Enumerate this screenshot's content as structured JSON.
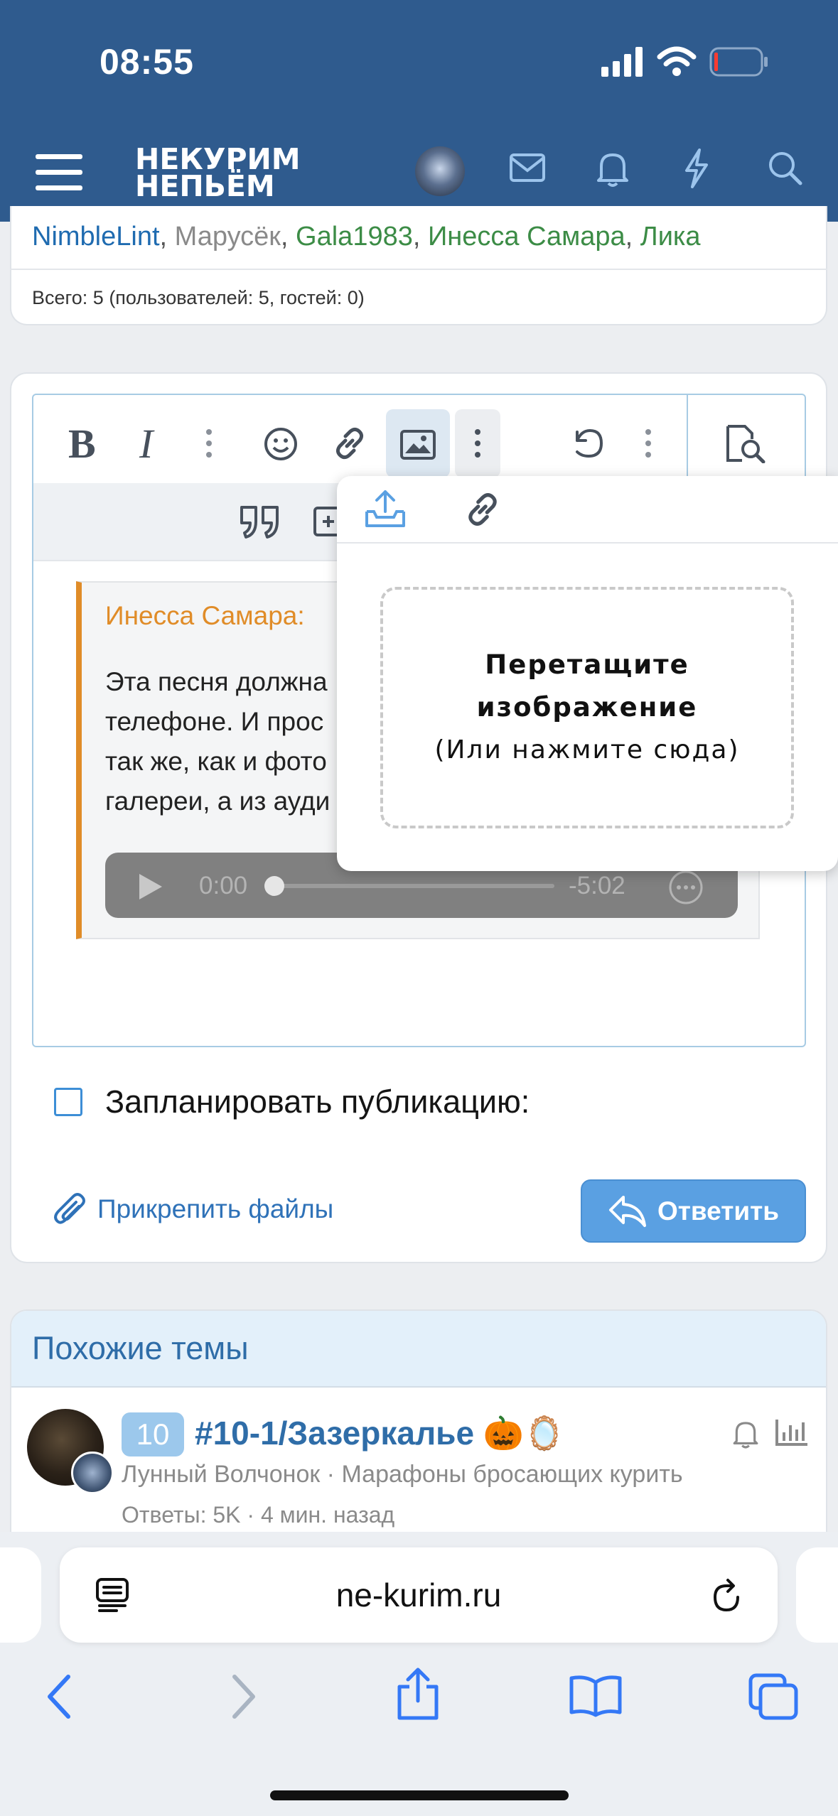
{
  "status_bar": {
    "time": "08:55"
  },
  "header": {
    "logo_line1": "НЕКУРИМ",
    "logo_line2": "НЕПЬЁМ"
  },
  "online": {
    "names": [
      {
        "text": "NimbleLint",
        "style": "blue"
      },
      {
        "text": "Марусёк",
        "style": "grey"
      },
      {
        "text": "Gala1983",
        "style": "green"
      },
      {
        "text": "Инесса Самара",
        "style": "green"
      },
      {
        "text": "Лика",
        "style": "green"
      }
    ],
    "separator": ", ",
    "total": "Всего: 5 (пользователей: 5, гостей: 0)"
  },
  "editor": {
    "quote_author": "Инесса Самара:",
    "quote_lines": [
      "Эта песня должна",
      "телефоне. И прос",
      "так же, как и фото",
      "галереи, а из ауди"
    ],
    "audio": {
      "current": "0:00",
      "remaining": "-5:02"
    }
  },
  "image_popup": {
    "drop_title": "Перетащите изображение",
    "drop_subtitle": "(Или нажмите сюда)"
  },
  "schedule_label": "Запланировать публикацию:",
  "attach_label": "Прикрепить файлы",
  "reply_label": "Ответить",
  "similar": {
    "title": "Похожие темы",
    "thread": {
      "badge": "10",
      "title": "#10-1/Зазеркалье 🎃🪞",
      "meta": "Лунный Волчонок · Марафоны бросающих курить",
      "stats": "Ответы: 5K · 4 мин. назад"
    }
  },
  "browser": {
    "url": "ne-kurim.ru"
  },
  "colors": {
    "header": "#2f5b8e",
    "accent": "#5aa0e2",
    "quote_border": "#e08c28"
  }
}
